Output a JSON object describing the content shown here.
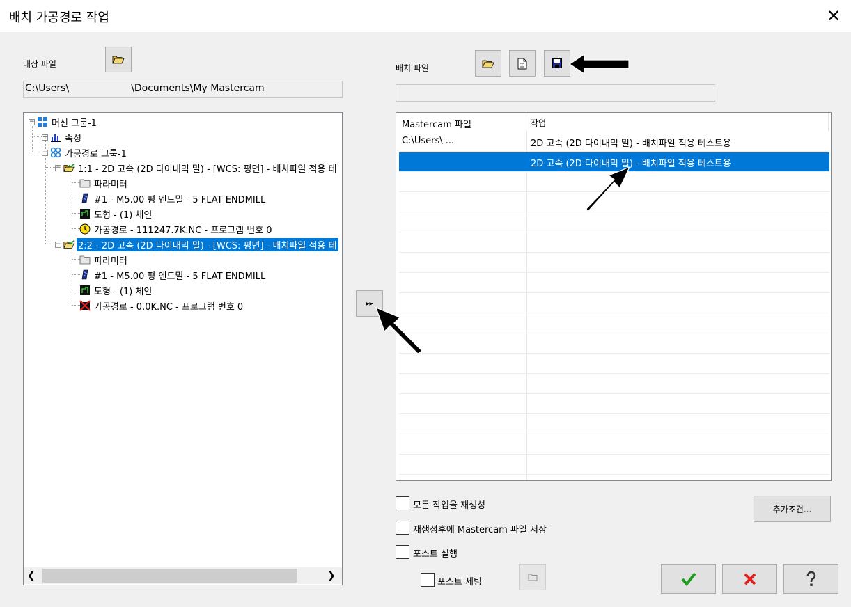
{
  "window": {
    "title": "배치 가공경로 작업",
    "close_label": "✕"
  },
  "source": {
    "label": "대상 파일",
    "path": "C:\\Users\\                    \\Documents\\My Mastercam"
  },
  "batch": {
    "label": "배치 파일",
    "path": ""
  },
  "tree": {
    "machine_group": "머신 그룹-1",
    "properties": "속성",
    "toolpath_group": "가공경로 그룹-1",
    "op1": {
      "label": "1:1 - 2D 고속 (2D 다이내믹 밀) - [WCS: 평면] - 배치파일 적용 테",
      "params": "파라미터",
      "tool": "#1 - M5.00 평 엔드밀 - 5 FLAT ENDMILL",
      "geometry": "도형 - (1) 체인",
      "toolpath": "가공경로 - 111247.7K.NC - 프로그램 번호 0"
    },
    "op2": {
      "label": "2:2 - 2D 고속 (2D 다이내믹 밀) - [WCS: 평면] - 배치파일 적용 테",
      "params": "파라미터",
      "tool": "#1 - M5.00 평 엔드밀 - 5 FLAT ENDMILL",
      "geometry": "도형 - (1) 체인",
      "toolpath": "가공경로 - 0.0K.NC - 프로그램 번호 0"
    }
  },
  "transfer": {
    "label": "▸▸"
  },
  "list": {
    "col_file": "Mastercam 파일",
    "col_op": "작업",
    "rows": [
      {
        "file": "C:\\Users\\            ...",
        "op": "2D 고속 (2D 다이내믹 밀) - 배치파일 적용 테스트용"
      },
      {
        "file": "",
        "op": "2D 고속 (2D 다이내믹 밀) - 배치파일 적용 테스트용"
      }
    ]
  },
  "options": {
    "regen_all": "모든 작업을 재생성",
    "save_after": "재생성후에 Mastercam 파일 저장",
    "run_post": "포스트 실행",
    "post_settings": "포스트 세팅",
    "extra": "추가조건..."
  },
  "colors": {
    "accent": "#0078d7",
    "ok": "#1e9e1e",
    "cancel": "#e02020"
  }
}
